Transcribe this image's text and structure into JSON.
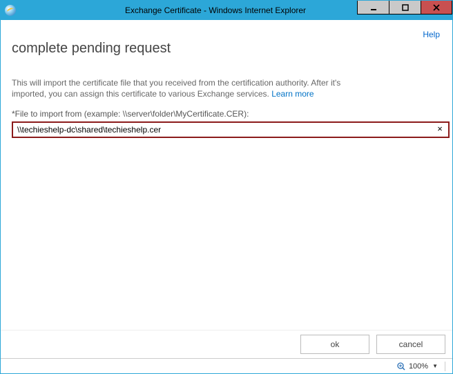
{
  "window": {
    "title": "Exchange Certificate - Windows Internet Explorer"
  },
  "header": {
    "help": "Help"
  },
  "page": {
    "title": "complete pending request",
    "description_a": "This will import the certificate file that you received from the certification authority. After it's imported, you can assign this certificate to various Exchange services. ",
    "learn_more": "Learn more"
  },
  "form": {
    "file_label": "*File to import from (example: \\\\server\\folder\\MyCertificate.CER):",
    "file_value": "\\\\techieshelp-dc\\shared\\techieshelp.cer",
    "clear": "×"
  },
  "footer": {
    "ok": "ok",
    "cancel": "cancel"
  },
  "status": {
    "zoom": "100%"
  }
}
